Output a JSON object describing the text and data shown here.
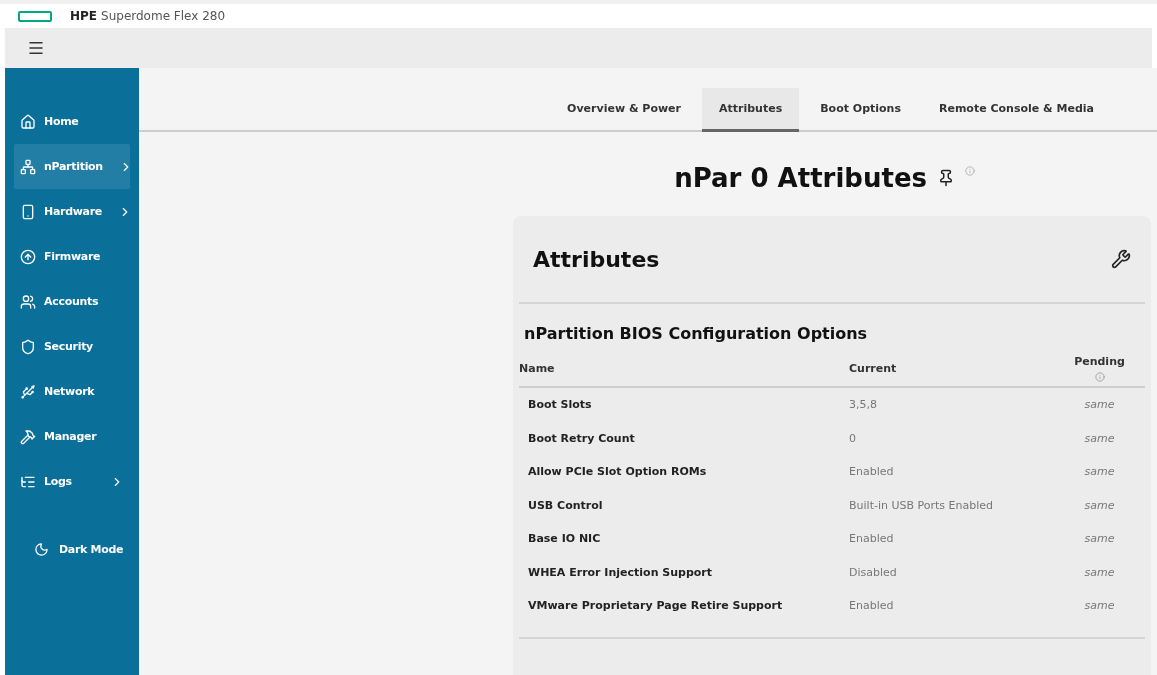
{
  "brand": {
    "logo_text": "HPE",
    "product": "Superdome Flex 280"
  },
  "sidebar": {
    "items": [
      {
        "label": "Home",
        "selected": false,
        "has_submenu": false
      },
      {
        "label": "nPartition",
        "selected": true,
        "has_submenu": true
      },
      {
        "label": "Hardware",
        "selected": false,
        "has_submenu": true
      },
      {
        "label": "Firmware",
        "selected": false,
        "has_submenu": false
      },
      {
        "label": "Accounts",
        "selected": false,
        "has_submenu": false
      },
      {
        "label": "Security",
        "selected": false,
        "has_submenu": false
      },
      {
        "label": "Network",
        "selected": false,
        "has_submenu": false
      },
      {
        "label": "Manager",
        "selected": false,
        "has_submenu": false
      },
      {
        "label": "Logs",
        "selected": false,
        "has_submenu": true
      }
    ],
    "dark_mode": "Dark Mode"
  },
  "tabs": [
    {
      "label": "Overview & Power",
      "selected": false
    },
    {
      "label": "Attributes",
      "selected": true
    },
    {
      "label": "Boot Options",
      "selected": false
    },
    {
      "label": "Remote Console & Media",
      "selected": false
    }
  ],
  "page_title": "nPar 0 Attributes",
  "card": {
    "title": "Attributes",
    "section": "nPartition BIOS Configuration Options",
    "columns": [
      "Name",
      "Current",
      "Pending"
    ],
    "rows": [
      {
        "name": "Boot Slots",
        "current": "3,5,8",
        "pending": "same"
      },
      {
        "name": "Boot Retry Count",
        "current": "0",
        "pending": "same"
      },
      {
        "name": "Allow PCIe Slot Option ROMs",
        "current": "Enabled",
        "pending": "same"
      },
      {
        "name": "USB Control",
        "current": "Built-in USB Ports Enabled",
        "pending": "same"
      },
      {
        "name": "Base IO NIC",
        "current": "Enabled",
        "pending": "same"
      },
      {
        "name": "WHEA Error Injection Support",
        "current": "Disabled",
        "pending": "same"
      },
      {
        "name": "VMware Proprietary Page Retire Support",
        "current": "Enabled",
        "pending": "same"
      }
    ]
  }
}
